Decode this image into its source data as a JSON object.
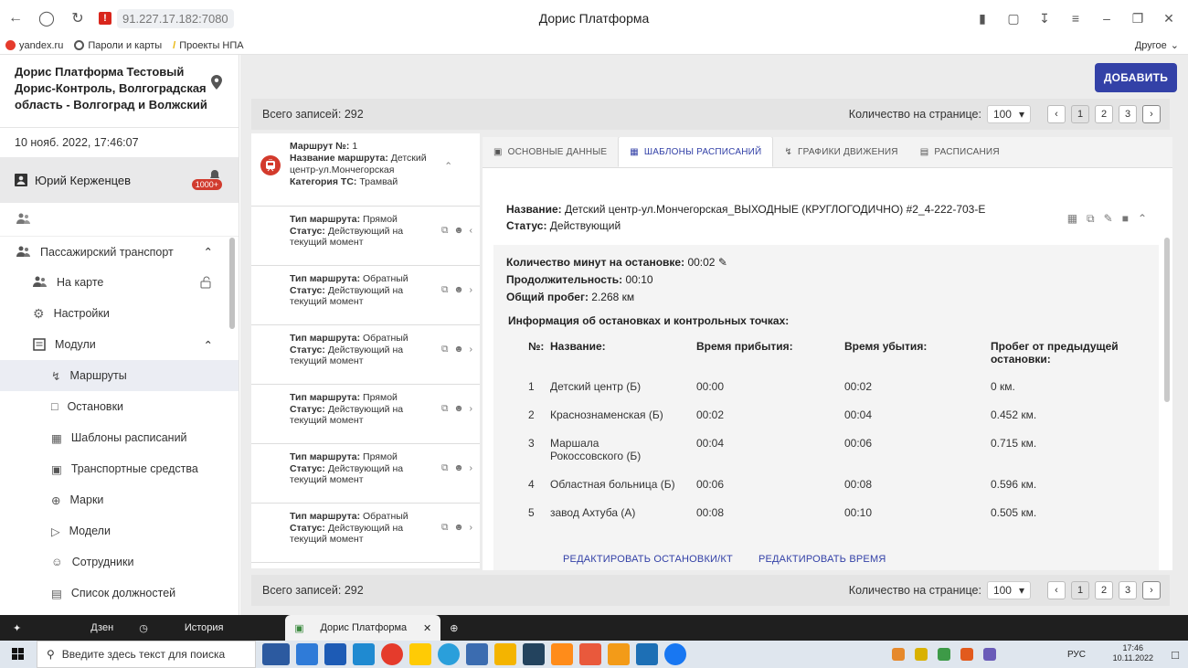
{
  "browser": {
    "url": "91.227.17.182:7080",
    "window_title": "Дорис Платформа",
    "bookmarks": [
      "yandex.ru",
      "Пароли и карты",
      "Проекты НПА"
    ],
    "bookmarks_other": "Другое"
  },
  "sidebar": {
    "org": "Дорис Платформа Тестовый Дорис-Контроль, Волгоградская область - Волгоград и Волжский",
    "datetime": "10 нояб. 2022, 17:46:07",
    "user_name": "Юрий Керженцев",
    "notif_badge": "1000+",
    "items": [
      {
        "label": "Пассажирский транспорт"
      },
      {
        "label": "На карте"
      },
      {
        "label": "Настройки"
      },
      {
        "label": "Модули"
      },
      {
        "label": "Маршруты"
      },
      {
        "label": "Остановки"
      },
      {
        "label": "Шаблоны расписаний"
      },
      {
        "label": "Транспортные средства"
      },
      {
        "label": "Марки"
      },
      {
        "label": "Модели"
      },
      {
        "label": "Сотрудники"
      },
      {
        "label": "Список должностей"
      }
    ]
  },
  "main": {
    "add_button": "ДОБАВИТЬ",
    "total": "Всего записей: 292",
    "per_page_label": "Количество на странице:",
    "per_page_value": "100",
    "pages": [
      "1",
      "2",
      "3"
    ],
    "route": {
      "number_label": "Маршрут №:",
      "number": "1",
      "name_label": "Название маршрута:",
      "name": "Детский центр-ул.Мончегорская",
      "category_label": "Категория ТС:",
      "category": "Трамвай"
    },
    "variants": [
      {
        "type": "Прямой",
        "status": "Действующий на текущий момент"
      },
      {
        "type": "Обратный",
        "status": "Действующий на текущий момент"
      },
      {
        "type": "Обратный",
        "status": "Действующий на текущий момент"
      },
      {
        "type": "Прямой",
        "status": "Действующий на текущий момент"
      },
      {
        "type": "Прямой",
        "status": "Действующий на текущий момент"
      },
      {
        "type": "Обратный",
        "status": "Действующий на текущий момент"
      }
    ],
    "type_label": "Тип маршрута:",
    "status_label": "Статус:",
    "tabs": [
      "ОСНОВНЫЕ ДАННЫЕ",
      "ШАБЛОНЫ РАСПИСАНИЙ",
      "ГРАФИКИ ДВИЖЕНИЯ",
      "РАСПИСАНИЯ"
    ],
    "template": {
      "name_label": "Название:",
      "name": "Детский центр-ул.Мончегорская_ВЫХОДНЫЕ (КРУГЛОГОДИЧНО) #2_4-222-703-Е",
      "status_label": "Статус:",
      "status": "Действующий",
      "minutes_label": "Количество минут на остановке:",
      "minutes": "00:02",
      "duration_label": "Продолжительность:",
      "duration": "00:10",
      "mileage_label": "Общий пробег:",
      "mileage": "2.268 км",
      "info_title": "Информация об остановках и контрольных точках:",
      "columns": [
        "№:",
        "Название:",
        "Время прибытия:",
        "Время убытия:",
        "Пробег от предыдущей остановки:"
      ],
      "stops": [
        {
          "n": "1",
          "name": "Детский центр (Б)",
          "arr": "00:00",
          "dep": "00:02",
          "dist": "0 км."
        },
        {
          "n": "2",
          "name": "Краснознаменская (Б)",
          "arr": "00:02",
          "dep": "00:04",
          "dist": "0.452 км."
        },
        {
          "n": "3",
          "name": "Маршала Рокоссовского (Б)",
          "arr": "00:04",
          "dep": "00:06",
          "dist": "0.715 км."
        },
        {
          "n": "4",
          "name": "Областная больница (Б)",
          "arr": "00:06",
          "dep": "00:08",
          "dist": "0.596 км."
        },
        {
          "n": "5",
          "name": "завод Ахтуба (А)",
          "arr": "00:08",
          "dep": "00:10",
          "dist": "0.505 км."
        }
      ],
      "edit_stops": "РЕДАКТИРОВАТЬ ОСТАНОВКИ/КТ",
      "edit_time": "РЕДАКТИРОВАТЬ ВРЕМЯ"
    }
  },
  "taskbar": {
    "tabs": [
      "Дзен",
      "История",
      "Дорис Платформа"
    ],
    "search_placeholder": "Введите здесь текст для поиска",
    "lang": "РУС",
    "time": "17:46",
    "date": "10.11.2022"
  },
  "colors": {
    "accent": "#3341a7",
    "danger": "#d33a2c"
  }
}
